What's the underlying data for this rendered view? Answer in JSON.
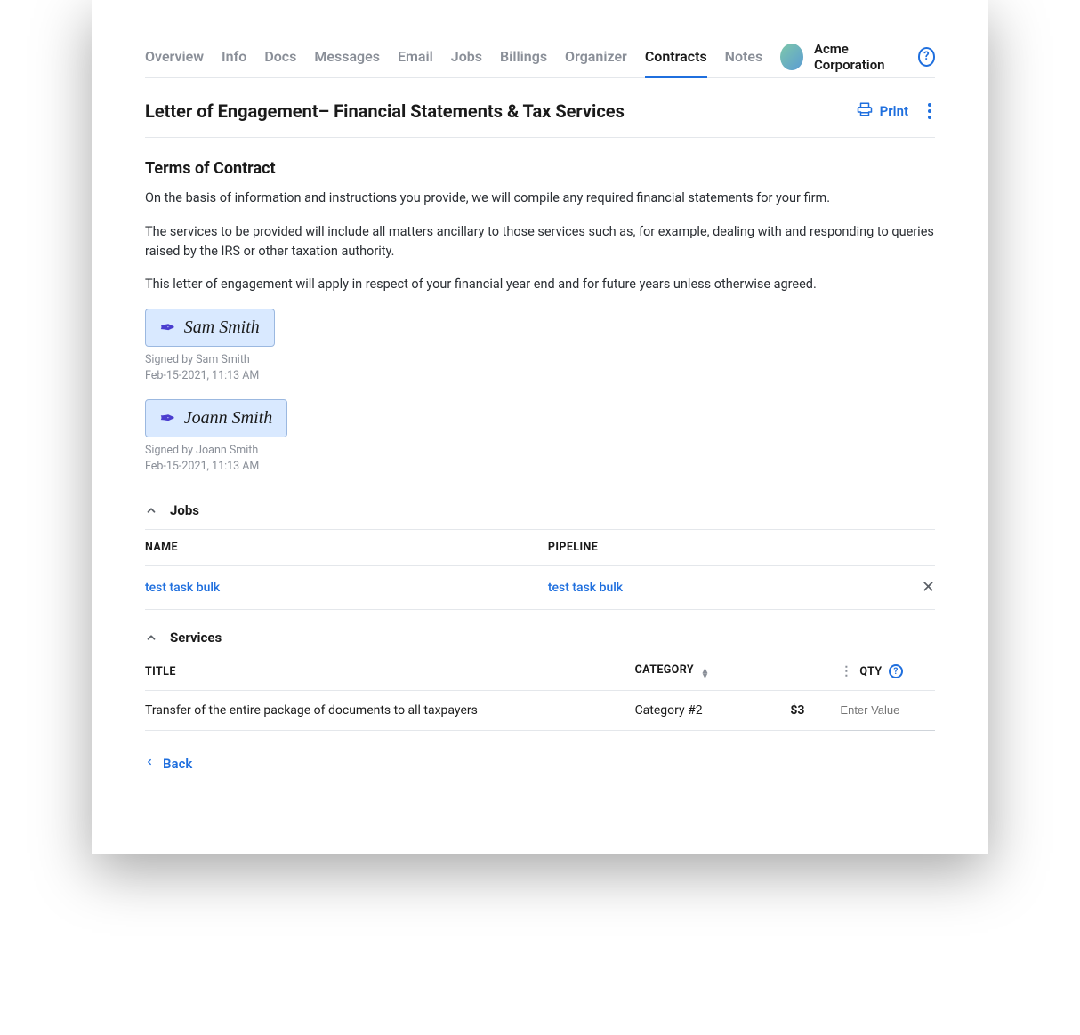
{
  "tabs": [
    "Overview",
    "Info",
    "Docs",
    "Messages",
    "Email",
    "Jobs",
    "Billings",
    "Organizer",
    "Contracts",
    "Notes"
  ],
  "active_tab_index": 8,
  "company": {
    "name": "Acme Corporation"
  },
  "doc": {
    "title": "Letter of Engagement– Financial Statements & Tax Services"
  },
  "actions": {
    "print_label": "Print"
  },
  "terms": {
    "heading": "Terms of Contract",
    "p1": "On the basis of information and instructions you provide, we will compile any required financial statements for your firm.",
    "p2": "The services to be provided will include all matters ancillary to those services such as, for example, dealing with and responding to queries raised by the IRS or other taxation authority.",
    "p3": "This letter of engagement will apply in respect of your financial year end and for future years unless otherwise agreed."
  },
  "signatures": [
    {
      "name": "Sam Smith",
      "signed_by": "Signed by Sam Smith",
      "timestamp": "Feb-15-2021, 11:13 AM"
    },
    {
      "name": "Joann Smith",
      "signed_by": "Signed by Joann Smith",
      "timestamp": "Feb-15-2021, 11:13 AM"
    }
  ],
  "jobs": {
    "section_label": "Jobs",
    "cols": {
      "name": "NAME",
      "pipeline": "PIPELINE"
    },
    "rows": [
      {
        "name": "test task bulk",
        "pipeline": "test task bulk"
      }
    ]
  },
  "services": {
    "section_label": "Services",
    "cols": {
      "title": "TITLE",
      "category": "CATEGORY",
      "qty": "QTY"
    },
    "rows": [
      {
        "title": "Transfer of the entire package of documents to all taxpayers",
        "category": "Category #2",
        "price": "$3"
      }
    ],
    "qty_placeholder": "Enter Value"
  },
  "back_label": "Back"
}
